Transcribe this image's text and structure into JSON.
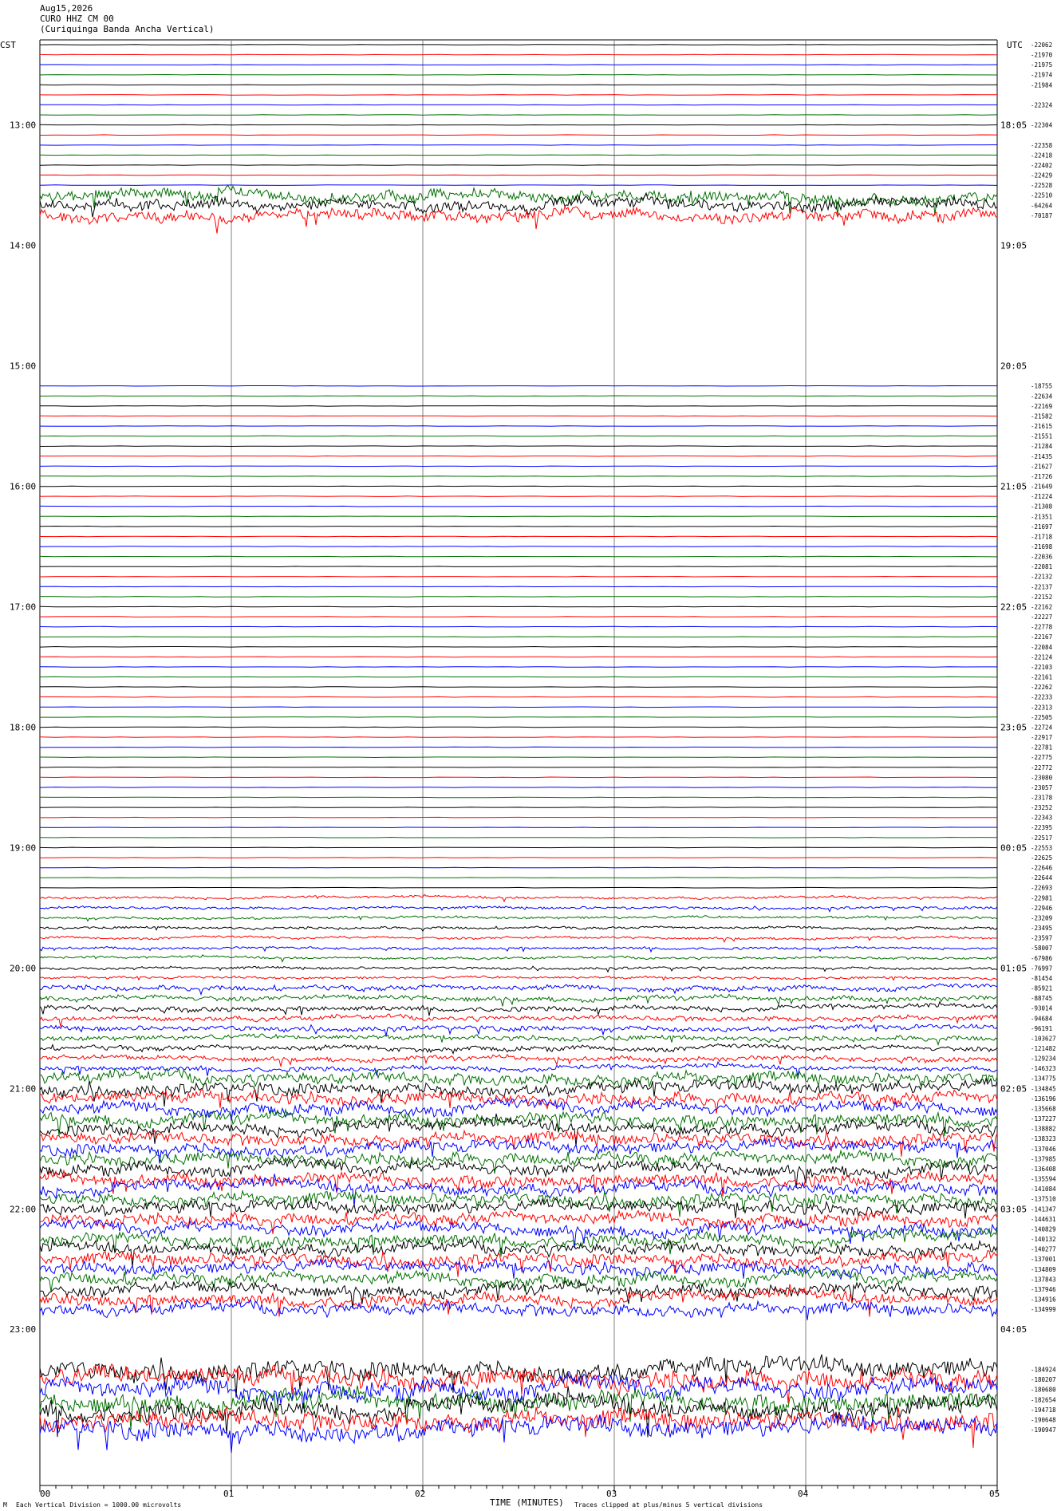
{
  "header": {
    "date": "Aug15,2026",
    "station": "CURO HHZ CM 00",
    "description": "(Curiquinga Banda Ancha Vertical)"
  },
  "left_tz": "CST",
  "right_tz": "UTC",
  "footer": {
    "scale": "Each Vertical Division = 1000.00 microvolts",
    "clip": "Traces clipped at plus/minus 5 vertical divisions",
    "mark": "M"
  },
  "colors": {
    "trace_cycle": [
      "#000000",
      "#ff0000",
      "#0000ff",
      "#007000"
    ],
    "grid": "#808080"
  },
  "chart_data": {
    "type": "line",
    "title": "",
    "xlabel": "TIME (MINUTES)",
    "x_ticks": [
      "00",
      "01",
      "02",
      "03",
      "04",
      "05"
    ],
    "xlim": [
      0,
      5
    ],
    "left_hour_labels": [
      "13:00",
      "14:00",
      "15:00",
      "16:00",
      "17:00",
      "18:00",
      "19:00",
      "20:00",
      "21:00",
      "22:00",
      "23:00"
    ],
    "right_hour_labels": [
      "18:05",
      "19:05",
      "20:05",
      "21:05",
      "22:05",
      "23:05",
      "00:05",
      "01:05",
      "02:05",
      "03:05",
      "04:05"
    ],
    "trace_count": 144,
    "traces_per_hour": 12,
    "first_trace_time": "12:20",
    "trace_offsets": [
      "-22062",
      "-21970",
      "-21975",
      "-21974",
      "-21984",
      "",
      "-22324",
      "",
      "-22304",
      "",
      "-22358",
      "-22418",
      "-22402",
      "-22429",
      "-22528",
      "-22510",
      "-64264",
      "-70187",
      "",
      "",
      "",
      "",
      "",
      "",
      "",
      "",
      "",
      "",
      "",
      "",
      "",
      "",
      "",
      "",
      "-18755",
      "-22634",
      "-22169",
      "-21582",
      "-21615",
      "-21551",
      "-21284",
      "-21435",
      "-21627",
      "-21726",
      "-21649",
      "-21224",
      "-21308",
      "-21351",
      "-21697",
      "-21718",
      "-21698",
      "-22036",
      "-22081",
      "-22132",
      "-22137",
      "-22152",
      "-22162",
      "-22227",
      "-22778",
      "-22167",
      "-22084",
      "-22124",
      "-22103",
      "-22161",
      "-22262",
      "-22233",
      "-22313",
      "-22505",
      "-22724",
      "-22917",
      "-22781",
      "-22775",
      "-22772",
      "-23080",
      "-23057",
      "-23178",
      "-23252",
      "-22343",
      "-22395",
      "-22517",
      "-22553",
      "-22625",
      "-22646",
      "-22644",
      "-22693",
      "-22981",
      "-22946",
      "-23209",
      "-23495",
      "-23597",
      "-58007",
      "-67986",
      "-76997",
      "-81454",
      "-85921",
      "-88745",
      "-93014",
      "-94684",
      "-96191",
      "-103627",
      "-121482",
      "-129234",
      "-146323",
      "-134775",
      "-134845",
      "-136196",
      "-135668",
      "-137227",
      "-138882",
      "-138323",
      "-137046",
      "-137985",
      "-136408",
      "-135594",
      "-141084",
      "-137510",
      "-141347",
      "-144631",
      "-140829",
      "-140132",
      "-140277",
      "-137001",
      "-134809",
      "-137843",
      "-137946",
      "-134916",
      "-134999",
      "",
      "",
      "",
      "",
      "",
      "-184924",
      "-180207",
      "-180680",
      "-182654",
      "-194718",
      "-190648",
      "-190947",
      "",
      "",
      "",
      "",
      ""
    ]
  }
}
